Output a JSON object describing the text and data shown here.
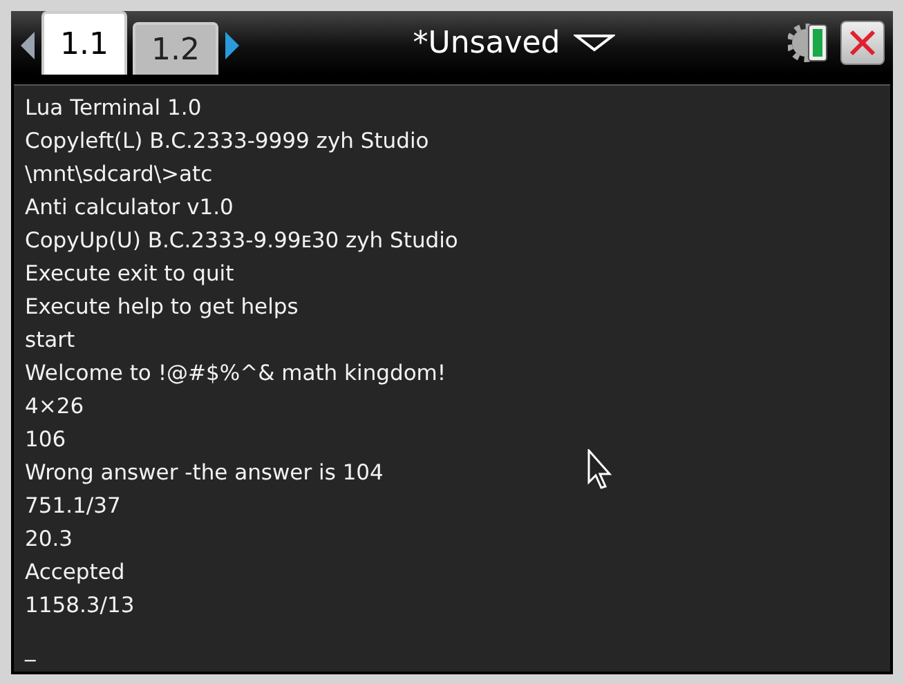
{
  "tabs": [
    {
      "label": "1.1",
      "selected": true
    },
    {
      "label": "1.2",
      "selected": false
    }
  ],
  "document": {
    "title": "*Unsaved"
  },
  "terminal": {
    "lines": [
      {
        "kind": "text",
        "text": "Lua Terminal 1.0"
      },
      {
        "kind": "text",
        "text": "Copyleft(L) B.C.2333-9999 zyh Studio"
      },
      {
        "kind": "text",
        "text": "\\mnt\\sdcard\\>atc"
      },
      {
        "kind": "text",
        "text": "Anti calculator v1.0"
      },
      {
        "kind": "text",
        "text": "CopyUp(U) B.C.2333-9.99ᴇ30 zyh Studio"
      },
      {
        "kind": "text",
        "text": "Execute exit to quit"
      },
      {
        "kind": "text",
        "text": "Execute help to get helps"
      },
      {
        "kind": "text",
        "text": "start"
      },
      {
        "kind": "text",
        "text": "Welcome to !@#$%^& math kingdom!"
      },
      {
        "kind": "text",
        "text": "4×26"
      },
      {
        "kind": "text",
        "text": "106"
      },
      {
        "kind": "text",
        "text": "Wrong answer -the answer is 104"
      },
      {
        "kind": "text",
        "text": "751.1/37"
      },
      {
        "kind": "text",
        "text": "20.3"
      },
      {
        "kind": "text",
        "text": "Accepted"
      },
      {
        "kind": "text",
        "text": "1158.3/13"
      },
      {
        "kind": "cursor",
        "text": "_"
      }
    ]
  }
}
